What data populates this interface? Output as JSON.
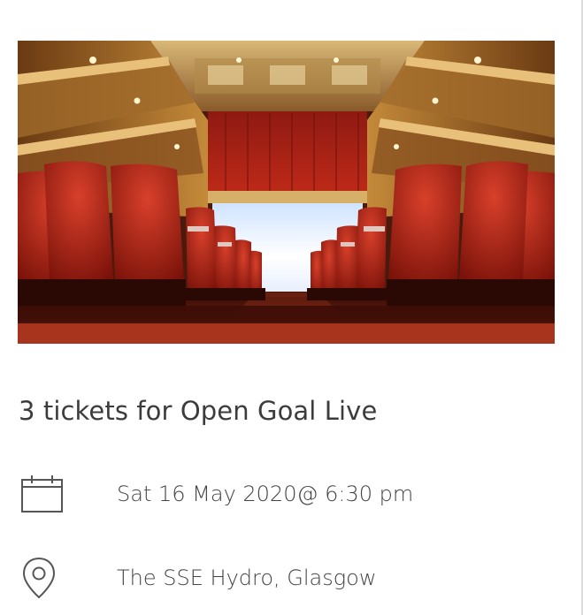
{
  "event": {
    "image_icon": "theatre-auditorium-photo",
    "title": "3 tickets for Open Goal Live",
    "date_icon": "calendar-icon",
    "date_text": "Sat 16 May 2020@ 6:30 pm",
    "venue_icon": "map-pin-icon",
    "venue_text": "The SSE Hydro, Glasgow"
  },
  "colors": {
    "text": "#3c3c3c",
    "seat_red": "#b22a1c",
    "gold": "#c9a35a"
  }
}
